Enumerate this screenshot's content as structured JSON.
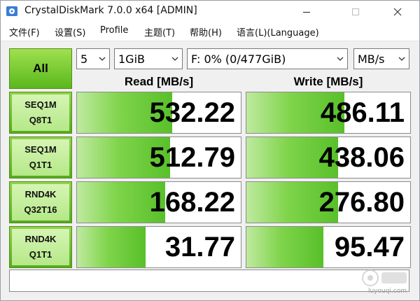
{
  "window": {
    "title": "CrystalDiskMark 7.0.0 x64 [ADMIN]"
  },
  "menu": [
    "文件(F)",
    "设置(S)",
    "Profile",
    "主题(T)",
    "帮助(H)",
    "语言(L)(Language)"
  ],
  "controls": {
    "all_label": "All",
    "count": "5",
    "size": "1GiB",
    "drive": "F: 0% (0/477GiB)",
    "unit": "MB/s"
  },
  "headers": {
    "read": "Read [MB/s]",
    "write": "Write [MB/s]"
  },
  "tests": [
    {
      "line1": "SEQ1M",
      "line2": "Q8T1",
      "read": "532.22",
      "write": "486.11",
      "read_fill": 0.58,
      "write_fill": 0.6
    },
    {
      "line1": "SEQ1M",
      "line2": "Q1T1",
      "read": "512.79",
      "write": "438.06",
      "read_fill": 0.57,
      "write_fill": 0.56
    },
    {
      "line1": "RND4K",
      "line2": "Q32T16",
      "read": "168.22",
      "write": "276.80",
      "read_fill": 0.54,
      "write_fill": 0.56
    },
    {
      "line1": "RND4K",
      "line2": "Q1T1",
      "read": "31.77",
      "write": "95.47",
      "read_fill": 0.42,
      "write_fill": 0.47
    }
  ],
  "comment": "",
  "watermark": "luyouqi.com",
  "colors": {
    "accent_green": "#5ab81c",
    "bar_green": "#58c02a"
  },
  "icons": {
    "app": "disk-icon",
    "minimize": "minimize-icon",
    "maximize": "maximize-icon",
    "close": "close-icon",
    "dropdown": "chevron-down-icon"
  }
}
